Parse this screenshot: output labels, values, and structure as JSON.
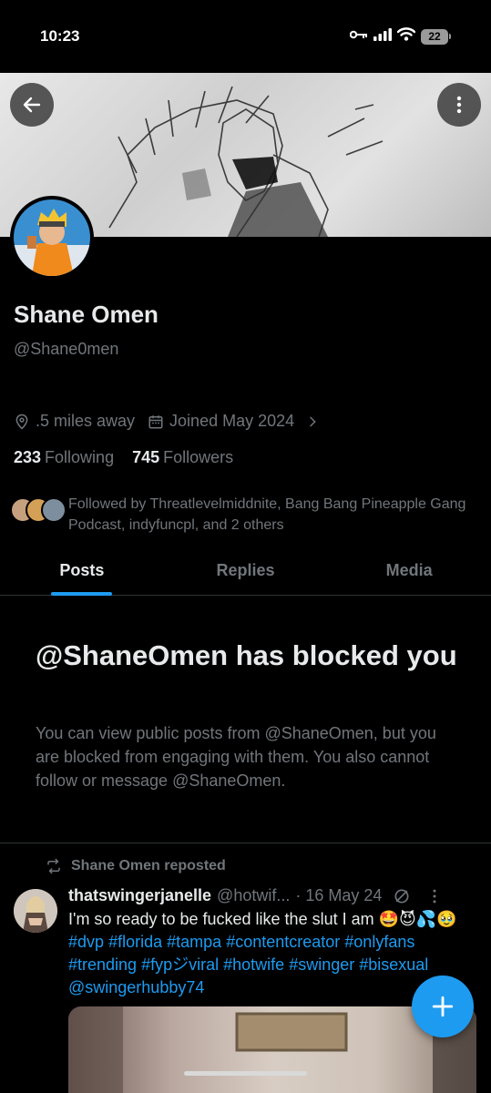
{
  "status_bar": {
    "time": "10:23",
    "battery": "22"
  },
  "profile": {
    "name": "Shane Omen",
    "handle": "@Shane0men",
    "location": ".5 miles away",
    "joined": "Joined May 2024",
    "following_count": "233",
    "following_label": "Following",
    "followers_count": "745",
    "followers_label": "Followers",
    "followed_by": "Followed by Threatlevelmiddnite, Bang Bang Pineapple Gang Podcast, indyfuncpl, and 2 others"
  },
  "tabs": [
    {
      "label": "Posts",
      "active": true
    },
    {
      "label": "Replies",
      "active": false
    },
    {
      "label": "Media",
      "active": false
    }
  ],
  "blocked": {
    "title": "@ShaneOmen has blocked you",
    "description": "You can view public posts from @ShaneOmen, but you are blocked from engaging with them. You also cannot follow or message @ShaneOmen."
  },
  "post": {
    "repost_label": "Shane Omen reposted",
    "author": "thatswingerjanelle",
    "handle": "@hotwif...",
    "date": "· 16 May 24",
    "text_start": "I'm so ready to be fucked like the slut I am 🤩😈💦🥹 ",
    "tags": [
      "#dvp",
      "#florida",
      "#tampa",
      "#contentcreator",
      "#onlyfans",
      "#trending",
      "#fypジviral",
      "#hotwife",
      "#swinger",
      "#bisexual",
      "@swingerhubby74"
    ]
  },
  "colors": {
    "accent": "#1d9bf0",
    "background": "#000000",
    "text_primary": "#e7e9ea",
    "text_secondary": "#71767b",
    "border": "#2f3336"
  }
}
